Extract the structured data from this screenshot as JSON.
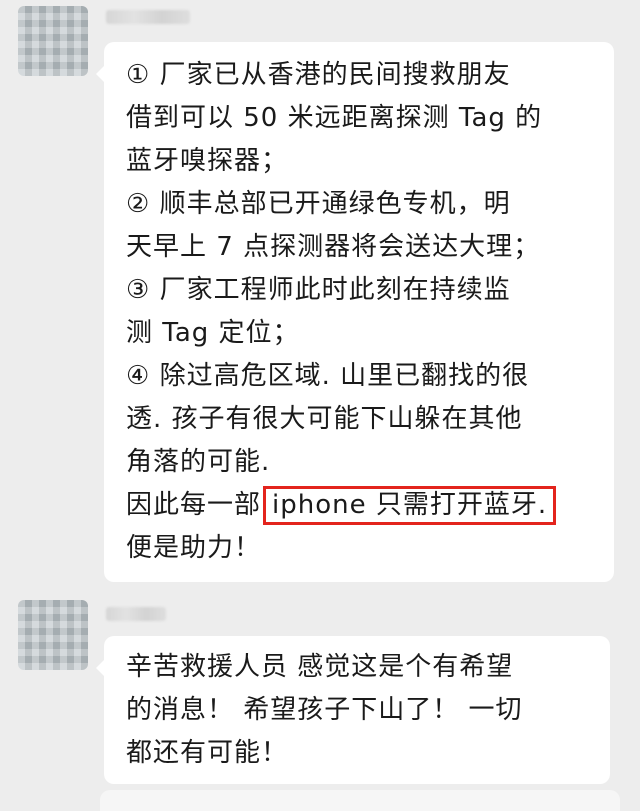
{
  "messages": [
    {
      "lines": [
        "① 厂家已从香港的民间搜救朋友",
        "借到可以 50 米远距离探测 Tag 的",
        "蓝牙嗅探器；",
        "② 顺丰总部已开通绿色专机，明",
        "天早上 7 点探测器将会送达大理；",
        "③ 厂家工程师此时此刻在持续监",
        "测 Tag 定位；",
        "④ 除过高危区域. 山里已翻找的很",
        "透. 孩子有很大可能下山躲在其他",
        "角落的可能."
      ],
      "line_prefix": "因此每一部",
      "highlight": "iphone 只需打开蓝牙.",
      "last_line": "便是助力！",
      "highlight_color": "#e3241d"
    },
    {
      "lines": [
        "辛苦救援人员 感觉这是个有希望",
        "的消息！ 希望孩子下山了！ 一切",
        "都还有可能！"
      ]
    }
  ]
}
